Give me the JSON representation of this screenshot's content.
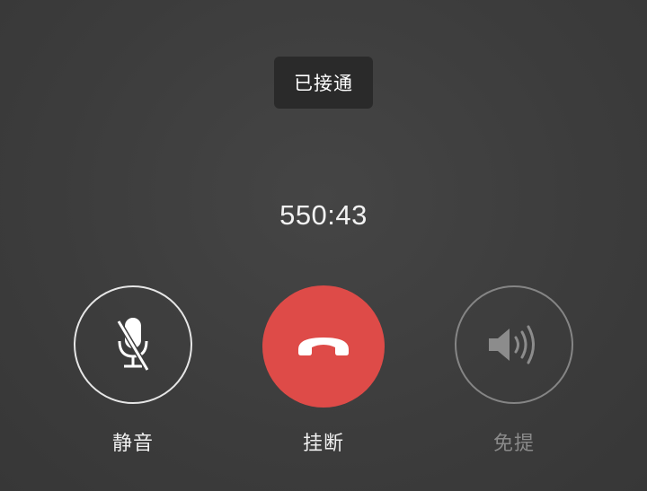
{
  "call": {
    "status": "已接通",
    "duration": "550:43"
  },
  "controls": {
    "mute": {
      "label": "静音",
      "icon": "mic-off-icon",
      "enabled": true
    },
    "hangup": {
      "label": "挂断",
      "icon": "phone-hangup-icon",
      "color": "#de4b48"
    },
    "speaker": {
      "label": "免提",
      "icon": "speaker-icon",
      "enabled": false
    }
  }
}
